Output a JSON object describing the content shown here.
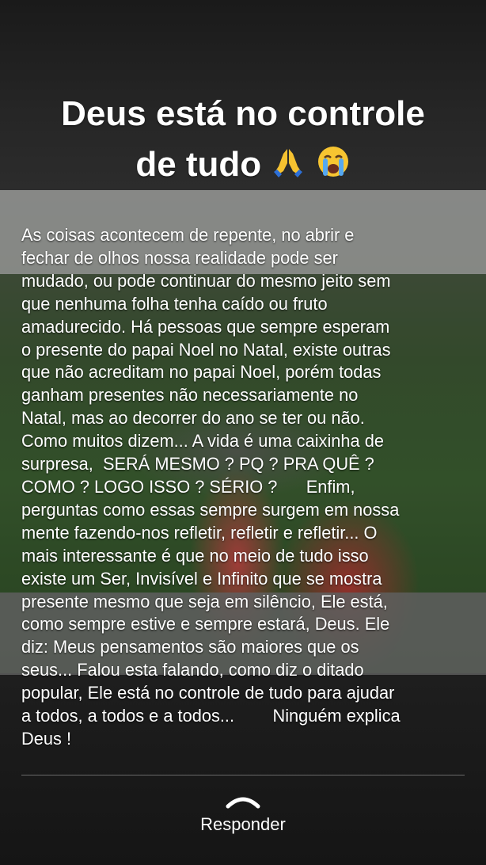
{
  "story": {
    "title_line1": "Deus está no controle",
    "title_line2": "de tudo",
    "title_emojis": [
      "folded-hands-icon",
      "crying-face-icon"
    ],
    "body_lines": [
      "As coisas acontecem de repente, no abrir e",
      "fechar de olhos nossa realidade pode ser",
      "mudado, ou pode continuar do mesmo jeito sem",
      "que nenhuma folha tenha caído ou fruto",
      "amadurecido. Há pessoas que sempre esperam",
      "o presente do papai Noel no Natal, existe outras",
      "que não acreditam no papai Noel, porém todas",
      "ganham presentes não necessariamente no",
      "Natal, mas ao decorrer do ano se ter ou não.",
      "Como muitos dizem... A vida é uma caixinha de",
      "surpresa,  SERÁ MESMO ? PQ ? PRA QUÊ ?",
      "COMO ? LOGO ISSO ? SÉRIO ?      Enfim,",
      "perguntas como essas sempre surgem em nossa",
      "mente fazendo-nos refletir, refletir e refletir... O",
      "mais interessante é que no meio de tudo isso",
      "existe um Ser, Invisível e Infinito que se mostra",
      "presente mesmo que seja em silêncio, Ele está,",
      "como sempre estive e sempre estará, Deus. Ele",
      "diz: Meus pensamentos são maiores que os",
      "seus... Falou esta falando, como diz o ditado",
      "popular, Ele está no controle de tudo para ajudar",
      "a todos, a todos e a todos...        Ninguém explica",
      "Deus !"
    ]
  },
  "reply": {
    "label": "Responder",
    "icon": "chevron-up-icon"
  },
  "colors": {
    "text": "#ffffff",
    "background": "#111111"
  }
}
